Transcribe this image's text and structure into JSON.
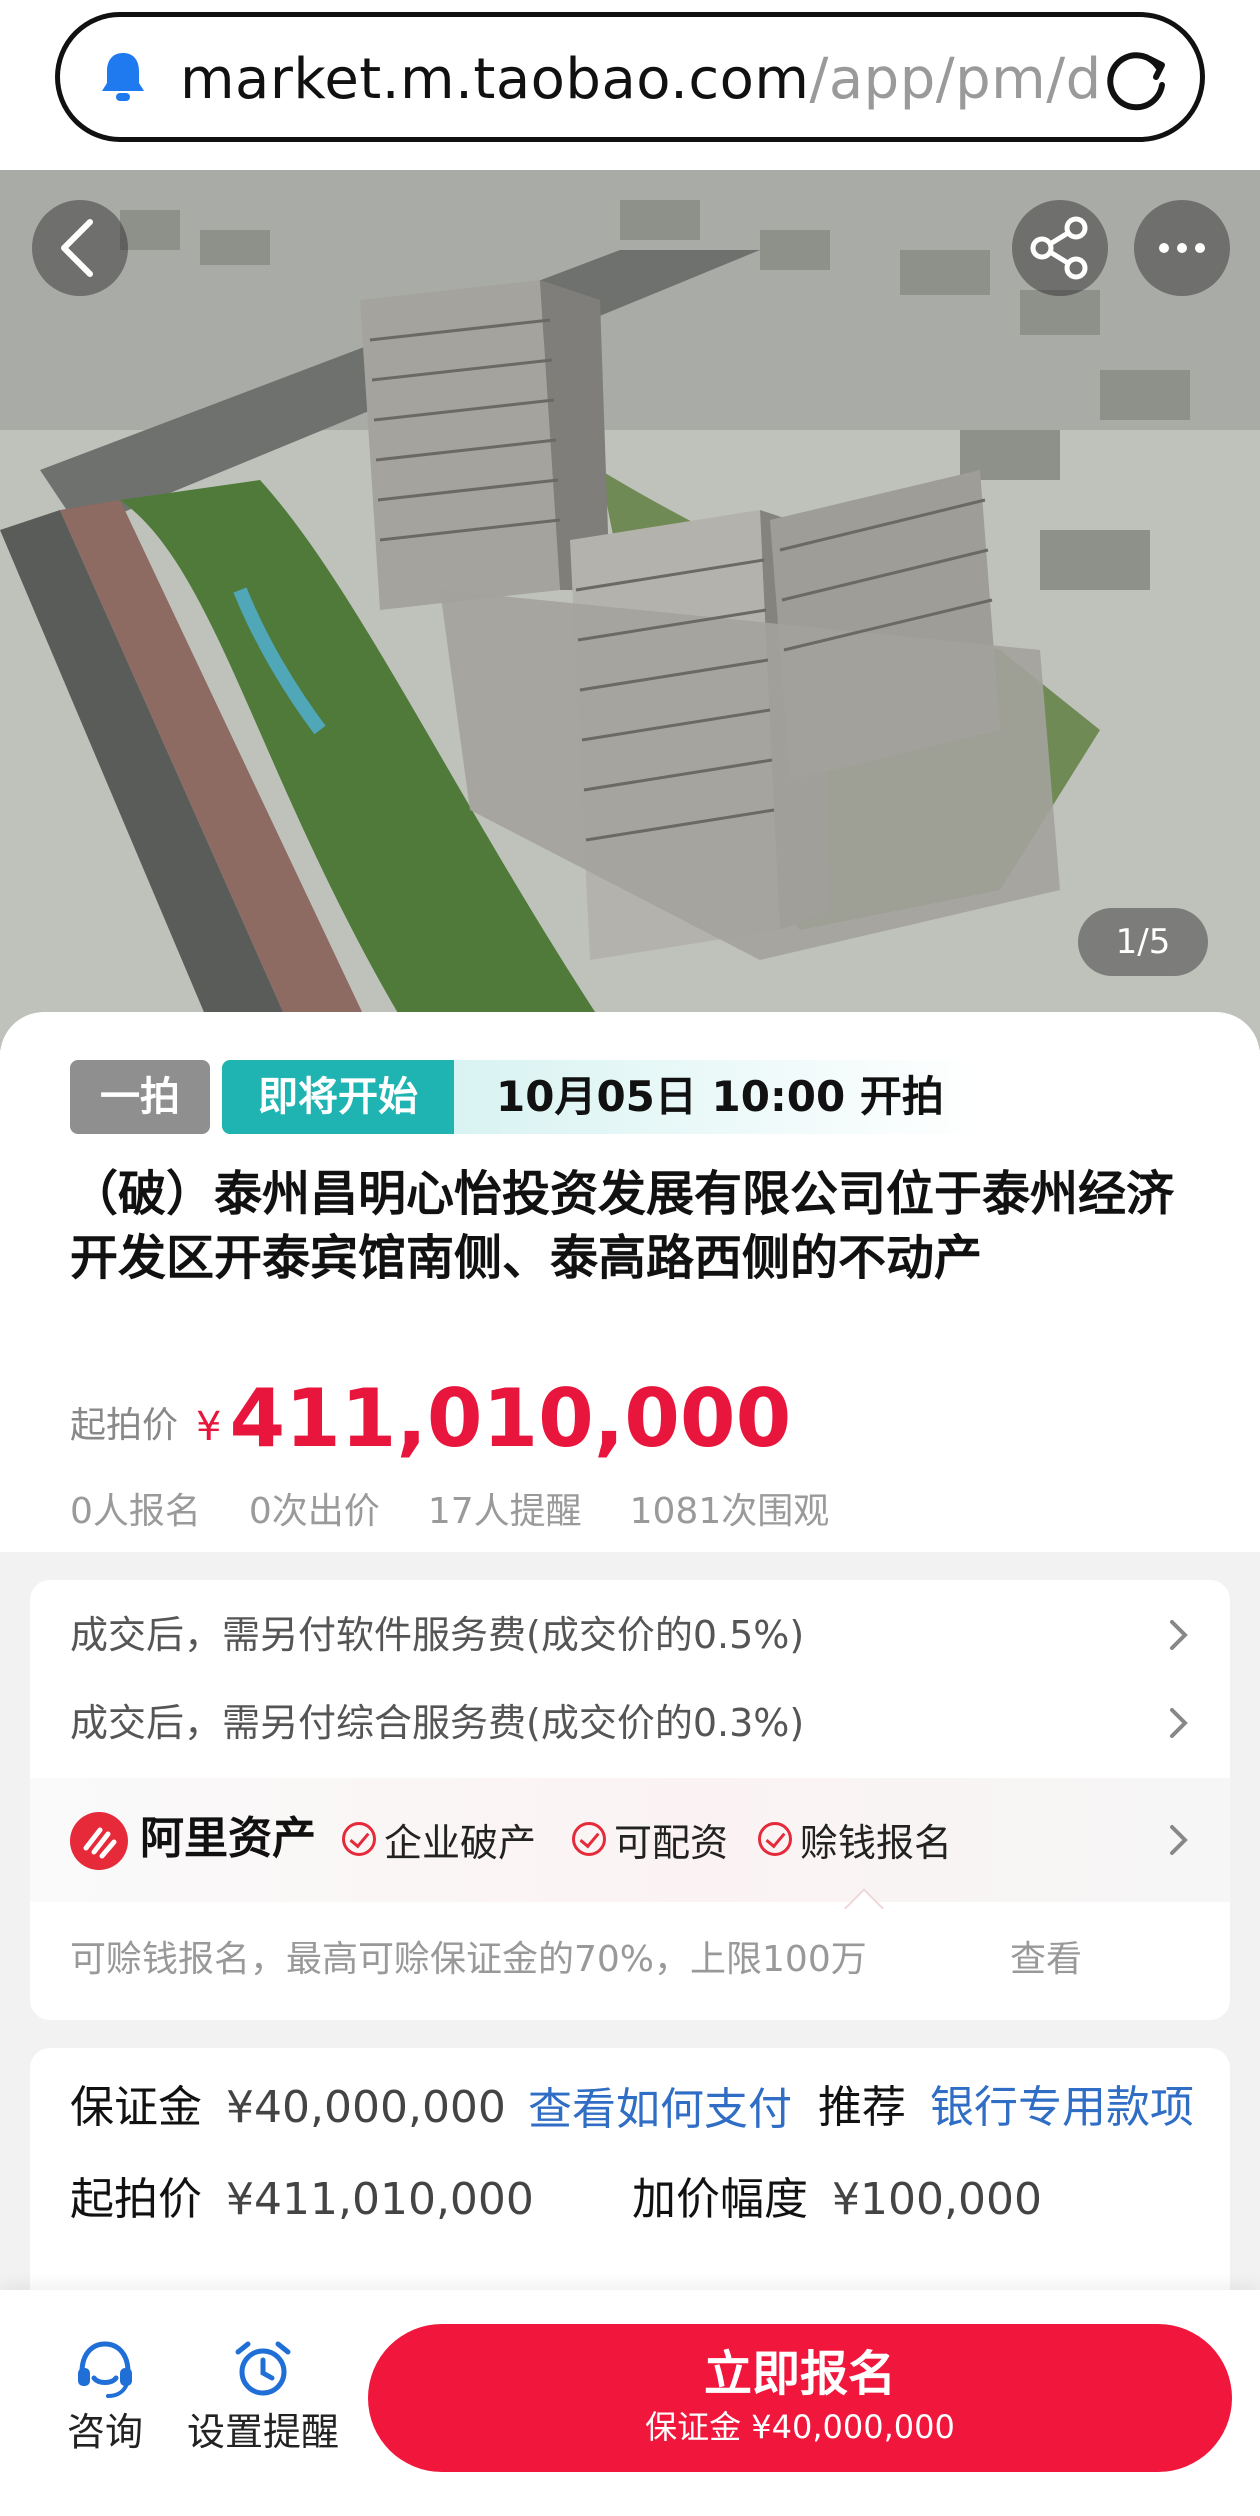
{
  "browser": {
    "url_host": "market.m.taobao.com",
    "url_path": "/app/pm/dzcw"
  },
  "gallery": {
    "counter": "1/5"
  },
  "auction": {
    "round_tag": "一拍",
    "status_tag": "即将开始",
    "start_time": "10月05日 10:00  开拍",
    "title": "（破）泰州昌明心怡投资发展有限公司位于泰州经济开发区开泰宾馆南侧、泰高路西侧的不动产",
    "price_label": "起拍价",
    "currency": "¥",
    "price": "411,010,000",
    "stats": {
      "registered": "0人报名",
      "bids": "0次出价",
      "reminders": "17人提醒",
      "views": "1081次围观"
    }
  },
  "fees": {
    "software_fee": "成交后，需另付软件服务费(成交价的0.5%)",
    "service_fee": "成交后，需另付综合服务费(成交价的0.3%)"
  },
  "ali": {
    "brand": "阿里资产",
    "tags": [
      "企业破产",
      "可配资",
      "赊钱报名"
    ],
    "loan_note": "可赊钱报名，最高可赊保证金的70%，上限100万",
    "view_link": "查看"
  },
  "deposit": {
    "deposit_label": "保证金",
    "deposit_value": "¥40,000,000",
    "how_to_pay": "查看如何支付",
    "recommend_label": "推荐",
    "bank_link": "银行专用款项",
    "start_price_label": "起拍价",
    "start_price_value": "¥411,010,000",
    "increment_label": "加价幅度",
    "increment_value": "¥100,000"
  },
  "bottom": {
    "consult_label": "咨询",
    "reminder_label": "设置提醒",
    "cta_label": "立即报名",
    "cta_sub": "保证金 ¥40,000,000"
  },
  "colors": {
    "accent_red": "#f0163c",
    "teal": "#1fb4b1",
    "link_blue": "#2f6ec4"
  },
  "icons": [
    "bell-icon",
    "reload-icon",
    "back-arrow-icon",
    "share-icon",
    "more-icon",
    "chevron-right-icon",
    "ali-logo-icon",
    "check-circle-icon",
    "headset-icon",
    "alarm-clock-icon"
  ]
}
